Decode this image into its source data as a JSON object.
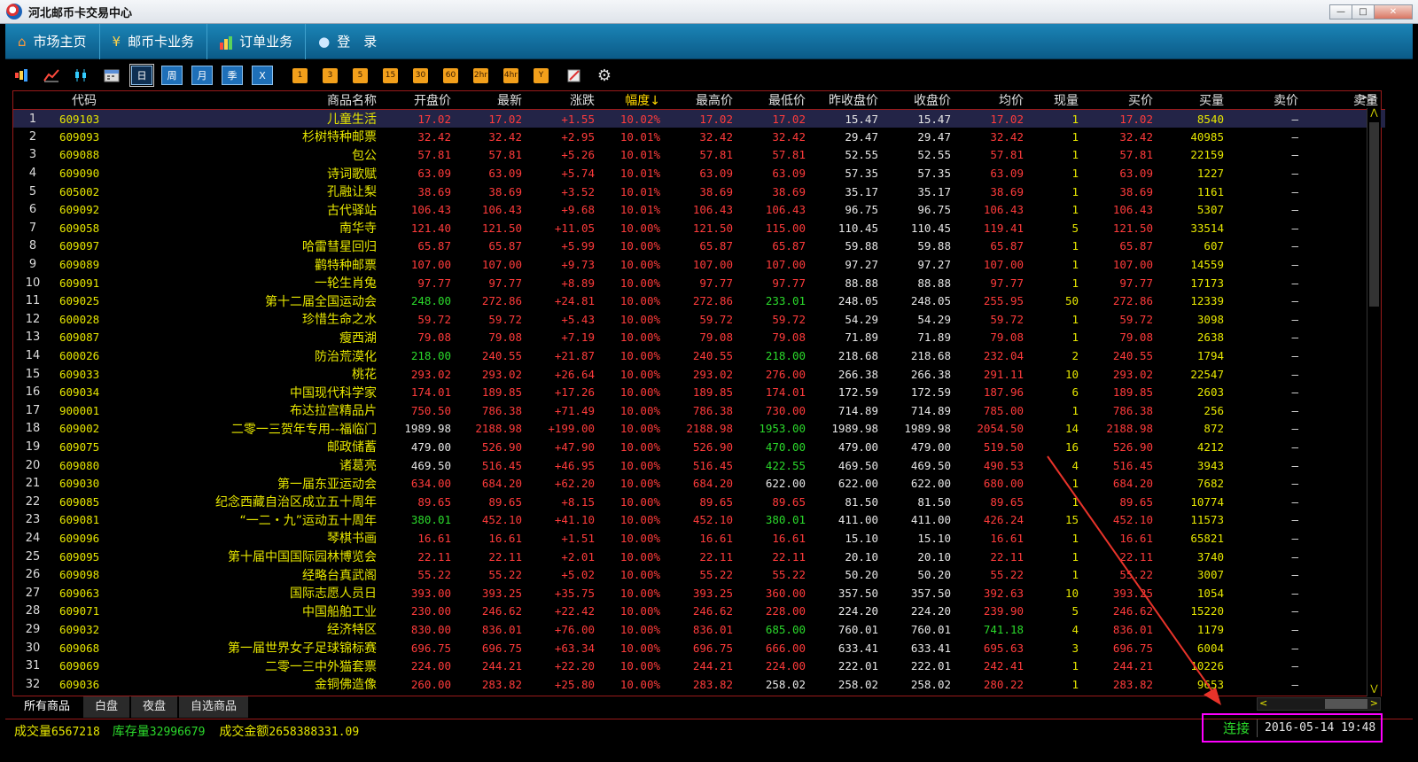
{
  "window": {
    "title": "河北邮币卡交易中心",
    "min": "—",
    "max": "□",
    "close": "✕"
  },
  "nav": [
    {
      "label": "市场主页",
      "icon": "home-icon",
      "glyph": "⌂"
    },
    {
      "label": "邮币卡业务",
      "icon": "yen-icon",
      "glyph": "¥"
    },
    {
      "label": "订单业务",
      "icon": "chart-icon",
      "glyph": "📊"
    },
    {
      "label": "登　录",
      "icon": "user-icon",
      "glyph": "●"
    }
  ],
  "toolbar": {
    "periods": [
      "日",
      "周",
      "月",
      "季",
      "X"
    ],
    "minutes": [
      "1",
      "3",
      "5",
      "15",
      "30",
      "60",
      "2hr",
      "4hr",
      "Y"
    ]
  },
  "columns": [
    "",
    "代码",
    "商品名称",
    "开盘价",
    "最新",
    "涨跌",
    "幅度↓",
    "最高价",
    "最低价",
    "昨收盘价",
    "收盘价",
    "均价",
    "现量",
    "买价",
    "买量",
    "卖价",
    "卖量"
  ],
  "more_columns": ">>",
  "rows": [
    [
      "1",
      "609103",
      "儿童生活",
      "17.02",
      "17.02",
      "+1.55",
      "10.02%",
      "17.02",
      "17.02",
      "15.47",
      "15.47",
      "17.02",
      "1",
      "17.02",
      "8540",
      "—",
      "—"
    ],
    [
      "2",
      "609093",
      "杉树特种邮票",
      "32.42",
      "32.42",
      "+2.95",
      "10.01%",
      "32.42",
      "32.42",
      "29.47",
      "29.47",
      "32.42",
      "1",
      "32.42",
      "40985",
      "—",
      "—"
    ],
    [
      "3",
      "609088",
      "包公",
      "57.81",
      "57.81",
      "+5.26",
      "10.01%",
      "57.81",
      "57.81",
      "52.55",
      "52.55",
      "57.81",
      "1",
      "57.81",
      "22159",
      "—",
      "—"
    ],
    [
      "4",
      "609090",
      "诗词歌赋",
      "63.09",
      "63.09",
      "+5.74",
      "10.01%",
      "63.09",
      "63.09",
      "57.35",
      "57.35",
      "63.09",
      "1",
      "63.09",
      "1227",
      "—",
      "—"
    ],
    [
      "5",
      "605002",
      "孔融让梨",
      "38.69",
      "38.69",
      "+3.52",
      "10.01%",
      "38.69",
      "38.69",
      "35.17",
      "35.17",
      "38.69",
      "1",
      "38.69",
      "1161",
      "—",
      "—"
    ],
    [
      "6",
      "609092",
      "古代驿站",
      "106.43",
      "106.43",
      "+9.68",
      "10.01%",
      "106.43",
      "106.43",
      "96.75",
      "96.75",
      "106.43",
      "1",
      "106.43",
      "5307",
      "—",
      "—"
    ],
    [
      "7",
      "609058",
      "南华寺",
      "121.40",
      "121.50",
      "+11.05",
      "10.00%",
      "121.50",
      "115.00",
      "110.45",
      "110.45",
      "119.41",
      "5",
      "121.50",
      "33514",
      "—",
      "—"
    ],
    [
      "8",
      "609097",
      "哈雷彗星回归",
      "65.87",
      "65.87",
      "+5.99",
      "10.00%",
      "65.87",
      "65.87",
      "59.88",
      "59.88",
      "65.87",
      "1",
      "65.87",
      "607",
      "—",
      "—"
    ],
    [
      "9",
      "609089",
      "鹳特种邮票",
      "107.00",
      "107.00",
      "+9.73",
      "10.00%",
      "107.00",
      "107.00",
      "97.27",
      "97.27",
      "107.00",
      "1",
      "107.00",
      "14559",
      "—",
      "—"
    ],
    [
      "10",
      "609091",
      "一轮生肖兔",
      "97.77",
      "97.77",
      "+8.89",
      "10.00%",
      "97.77",
      "97.77",
      "88.88",
      "88.88",
      "97.77",
      "1",
      "97.77",
      "17173",
      "—",
      "—"
    ],
    [
      "11",
      "609025",
      "第十二届全国运动会",
      "248.00",
      "272.86",
      "+24.81",
      "10.00%",
      "272.86",
      "233.01",
      "248.05",
      "248.05",
      "255.95",
      "50",
      "272.86",
      "12339",
      "—",
      "—"
    ],
    [
      "12",
      "600028",
      "珍惜生命之水",
      "59.72",
      "59.72",
      "+5.43",
      "10.00%",
      "59.72",
      "59.72",
      "54.29",
      "54.29",
      "59.72",
      "1",
      "59.72",
      "3098",
      "—",
      "—"
    ],
    [
      "13",
      "609087",
      "瘦西湖",
      "79.08",
      "79.08",
      "+7.19",
      "10.00%",
      "79.08",
      "79.08",
      "71.89",
      "71.89",
      "79.08",
      "1",
      "79.08",
      "2638",
      "—",
      "—"
    ],
    [
      "14",
      "600026",
      "防治荒漠化",
      "218.00",
      "240.55",
      "+21.87",
      "10.00%",
      "240.55",
      "218.00",
      "218.68",
      "218.68",
      "232.04",
      "2",
      "240.55",
      "1794",
      "—",
      "—"
    ],
    [
      "15",
      "609033",
      "桃花",
      "293.02",
      "293.02",
      "+26.64",
      "10.00%",
      "293.02",
      "276.00",
      "266.38",
      "266.38",
      "291.11",
      "10",
      "293.02",
      "22547",
      "—",
      "—"
    ],
    [
      "16",
      "609034",
      "中国现代科学家",
      "174.01",
      "189.85",
      "+17.26",
      "10.00%",
      "189.85",
      "174.01",
      "172.59",
      "172.59",
      "187.96",
      "6",
      "189.85",
      "2603",
      "—",
      "—"
    ],
    [
      "17",
      "900001",
      "布达拉宫精品片",
      "750.50",
      "786.38",
      "+71.49",
      "10.00%",
      "786.38",
      "730.00",
      "714.89",
      "714.89",
      "785.00",
      "1",
      "786.38",
      "256",
      "—",
      "—"
    ],
    [
      "18",
      "609002",
      "二零一三贺年专用--福临门",
      "1989.98",
      "2188.98",
      "+199.00",
      "10.00%",
      "2188.98",
      "1953.00",
      "1989.98",
      "1989.98",
      "2054.50",
      "14",
      "2188.98",
      "872",
      "—",
      "—"
    ],
    [
      "19",
      "609075",
      "邮政储蓄",
      "479.00",
      "526.90",
      "+47.90",
      "10.00%",
      "526.90",
      "470.00",
      "479.00",
      "479.00",
      "519.50",
      "16",
      "526.90",
      "4212",
      "—",
      "—"
    ],
    [
      "20",
      "609080",
      "诸葛亮",
      "469.50",
      "516.45",
      "+46.95",
      "10.00%",
      "516.45",
      "422.55",
      "469.50",
      "469.50",
      "490.53",
      "4",
      "516.45",
      "3943",
      "—",
      "—"
    ],
    [
      "21",
      "609030",
      "第一届东亚运动会",
      "634.00",
      "684.20",
      "+62.20",
      "10.00%",
      "684.20",
      "622.00",
      "622.00",
      "622.00",
      "680.00",
      "1",
      "684.20",
      "7682",
      "—",
      "—"
    ],
    [
      "22",
      "609085",
      "纪念西藏自治区成立五十周年",
      "89.65",
      "89.65",
      "+8.15",
      "10.00%",
      "89.65",
      "89.65",
      "81.50",
      "81.50",
      "89.65",
      "1",
      "89.65",
      "10774",
      "—",
      "—"
    ],
    [
      "23",
      "609081",
      "“一二・九”运动五十周年",
      "380.01",
      "452.10",
      "+41.10",
      "10.00%",
      "452.10",
      "380.01",
      "411.00",
      "411.00",
      "426.24",
      "15",
      "452.10",
      "11573",
      "—",
      "—"
    ],
    [
      "24",
      "609096",
      "琴棋书画",
      "16.61",
      "16.61",
      "+1.51",
      "10.00%",
      "16.61",
      "16.61",
      "15.10",
      "15.10",
      "16.61",
      "1",
      "16.61",
      "65821",
      "—",
      "—"
    ],
    [
      "25",
      "609095",
      "第十届中国国际园林博览会",
      "22.11",
      "22.11",
      "+2.01",
      "10.00%",
      "22.11",
      "22.11",
      "20.10",
      "20.10",
      "22.11",
      "1",
      "22.11",
      "3740",
      "—",
      "—"
    ],
    [
      "26",
      "609098",
      "经略台真武阁",
      "55.22",
      "55.22",
      "+5.02",
      "10.00%",
      "55.22",
      "55.22",
      "50.20",
      "50.20",
      "55.22",
      "1",
      "55.22",
      "3007",
      "—",
      "—"
    ],
    [
      "27",
      "609063",
      "国际志愿人员日",
      "393.00",
      "393.25",
      "+35.75",
      "10.00%",
      "393.25",
      "360.00",
      "357.50",
      "357.50",
      "392.63",
      "10",
      "393.25",
      "1054",
      "—",
      "—"
    ],
    [
      "28",
      "609071",
      "中国船舶工业",
      "230.00",
      "246.62",
      "+22.42",
      "10.00%",
      "246.62",
      "228.00",
      "224.20",
      "224.20",
      "239.90",
      "5",
      "246.62",
      "15220",
      "—",
      "—"
    ],
    [
      "29",
      "609032",
      "经济特区",
      "830.00",
      "836.01",
      "+76.00",
      "10.00%",
      "836.01",
      "685.00",
      "760.01",
      "760.01",
      "741.18",
      "4",
      "836.01",
      "1179",
      "—",
      "—"
    ],
    [
      "30",
      "609068",
      "第一届世界女子足球锦标赛",
      "696.75",
      "696.75",
      "+63.34",
      "10.00%",
      "696.75",
      "666.00",
      "633.41",
      "633.41",
      "695.63",
      "3",
      "696.75",
      "6004",
      "—",
      "—"
    ],
    [
      "31",
      "609069",
      "二零一三中外猫套票",
      "224.00",
      "244.21",
      "+22.20",
      "10.00%",
      "244.21",
      "224.00",
      "222.01",
      "222.01",
      "242.41",
      "1",
      "244.21",
      "10226",
      "—",
      "—"
    ],
    [
      "32",
      "609036",
      "金铜佛造像",
      "260.00",
      "283.82",
      "+25.80",
      "10.00%",
      "283.82",
      "258.02",
      "258.02",
      "258.02",
      "280.22",
      "1",
      "283.82",
      "9653",
      "—",
      "—"
    ]
  ],
  "tabs": [
    "所有商品",
    "白盘",
    "夜盘",
    "自选商品"
  ],
  "status": {
    "volume_label": "成交量",
    "volume": "6567218",
    "inventory_label": "库存量",
    "inventory": "32996679",
    "amount_label": "成交金额",
    "amount": "2658388331.09",
    "connection": "连接",
    "datetime": "2016-05-14 19:48"
  },
  "colors": {
    "up": "#ff3b3b",
    "down": "#2bd92b",
    "flat": "#e6e6e6",
    "name": "#e6e600",
    "annotation": "#e8332a",
    "highlight": "#ff00ff"
  }
}
